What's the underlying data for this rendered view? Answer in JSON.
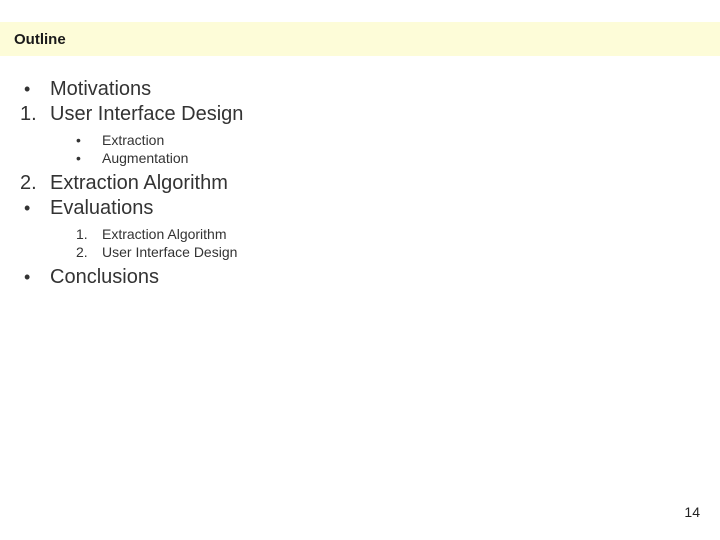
{
  "title": "Outline",
  "items": {
    "motivations": {
      "marker": "•",
      "label": "Motivations"
    },
    "uid": {
      "marker": "1.",
      "label": "User Interface Design"
    },
    "extraction": {
      "marker": "•",
      "label": "Extraction"
    },
    "augment": {
      "marker": "•",
      "label": "Augmentation"
    },
    "extalg": {
      "marker": "2.",
      "label": "Extraction Algorithm"
    },
    "evals": {
      "marker": "•",
      "label": "Evaluations"
    },
    "eval1": {
      "marker": "1.",
      "label": "Extraction Algorithm"
    },
    "eval2": {
      "marker": "2.",
      "label": "User Interface Design"
    },
    "concl": {
      "marker": "•",
      "label": "Conclusions"
    }
  },
  "page_number": "14"
}
